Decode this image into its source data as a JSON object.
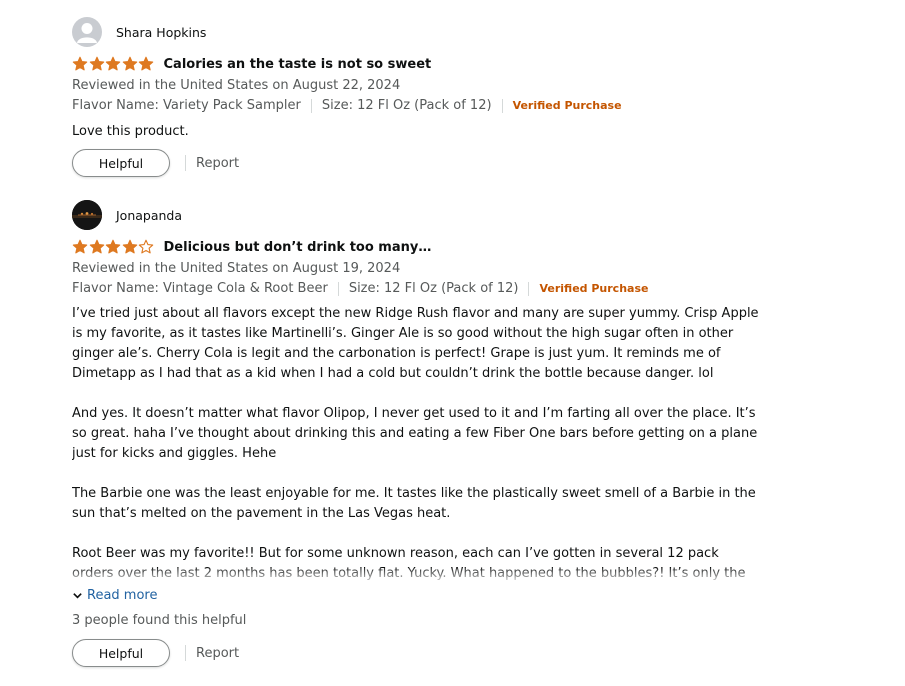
{
  "reviews": [
    {
      "reviewer": "Shara Hopkins",
      "rating": 5,
      "title": "Calories an the taste is not so sweet",
      "date_line": "Reviewed in the United States on August 22, 2024",
      "flavor": "Flavor Name: Variety Pack Sampler",
      "size": "Size: 12 Fl Oz (Pack of 12)",
      "verified": "Verified Purchase",
      "body": [
        "Love this product."
      ],
      "helpful_label": "Helpful",
      "report_label": "Report"
    },
    {
      "reviewer": "Jonapanda",
      "rating": 4,
      "title": "Delicious but don’t drink too many…",
      "date_line": "Reviewed in the United States on August 19, 2024",
      "flavor": "Flavor Name: Vintage Cola & Root Beer",
      "size": "Size: 12 Fl Oz (Pack of 12)",
      "verified": "Verified Purchase",
      "body": [
        "I’ve tried just about all flavors except the new Ridge Rush flavor and many are super yummy. Crisp Apple is my favorite, as it tastes like Martinelli’s. Ginger Ale is so good without the high sugar often in other ginger ale’s. Cherry Cola is legit and the carbonation is perfect! Grape is just yum. It reminds me of Dimetapp as I had that as a kid when I had a cold but couldn’t drink the bottle because danger. lol",
        "And yes. It doesn’t matter what flavor Olipop, I never get used to it and I’m farting all over the place. It’s so great. haha I’ve thought about drinking this and eating a few Fiber One bars before getting on a plane just for kicks and giggles. Hehe",
        "The Barbie one was the least enjoyable for me. It tastes like the plastically sweet smell of a Barbie in the sun that’s melted on the pavement in the Las Vegas heat.",
        "Root Beer was my favorite!! But for some unknown reason, each can I’ve gotten in several 12 pack orders over the last 2 months has been totally flat. Yucky. What happened to the bubbles?! It’s only the Root Beer."
      ],
      "read_more": "Read more",
      "found_helpful": "3 people found this helpful",
      "helpful_label": "Helpful",
      "report_label": "Report"
    }
  ],
  "colors": {
    "star": "#de7921",
    "verified": "#c45500",
    "link": "#2162a1",
    "meta": "#565959"
  },
  "icons": {
    "avatar_default": "person-silhouette-icon",
    "star": "star-icon",
    "read_more": "chevron-down-icon"
  }
}
